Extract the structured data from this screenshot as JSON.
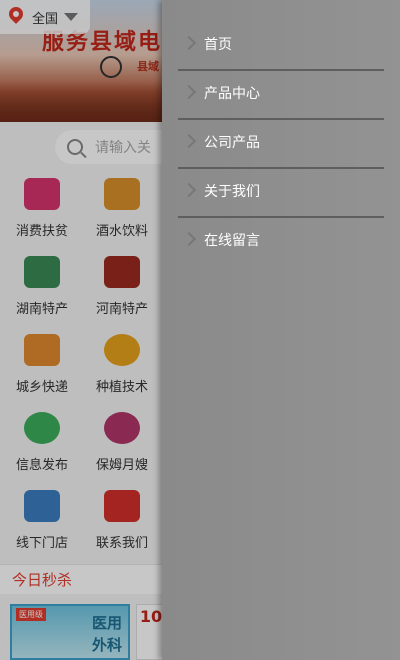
{
  "location": {
    "city": "全国"
  },
  "banner": {
    "title": "服务县域电",
    "subtitle": "县域"
  },
  "search": {
    "placeholder": "请输入关"
  },
  "categories": [
    {
      "label": "消费扶贫",
      "icon": "leaf-logo-icon",
      "color": "#d7346e"
    },
    {
      "label": "酒水饮料",
      "icon": "beer-mug-icon",
      "color": "#d9902b"
    },
    {
      "label": "湖南特产",
      "icon": "hunan-logo-icon",
      "color": "#3a8a55"
    },
    {
      "label": "河南特产",
      "icon": "henan-logo-icon",
      "color": "#9b2b1f"
    },
    {
      "label": "城乡快递",
      "icon": "truck-icon",
      "color": "#e08a2e"
    },
    {
      "label": "种植技术",
      "icon": "plant-icon",
      "color": "#e6a21d"
    },
    {
      "label": "信息发布",
      "icon": "wifi-icon",
      "color": "#3cae5c"
    },
    {
      "label": "保姆月嫂",
      "icon": "caregiver-icon",
      "color": "#b1366a"
    },
    {
      "label": "线下门店",
      "icon": "store-icon",
      "color": "#3b7dbf"
    },
    {
      "label": "联系我们",
      "icon": "phone-icon",
      "color": "#d12f2b"
    }
  ],
  "section": {
    "title": "今日秒杀"
  },
  "promo": {
    "tag": "医用级",
    "line1": "医用",
    "line2": "外科",
    "number": "10"
  },
  "drawer": {
    "items": [
      {
        "label": "首页"
      },
      {
        "label": "产品中心"
      },
      {
        "label": "公司产品"
      },
      {
        "label": "关于我们"
      },
      {
        "label": "在线留言"
      }
    ]
  }
}
